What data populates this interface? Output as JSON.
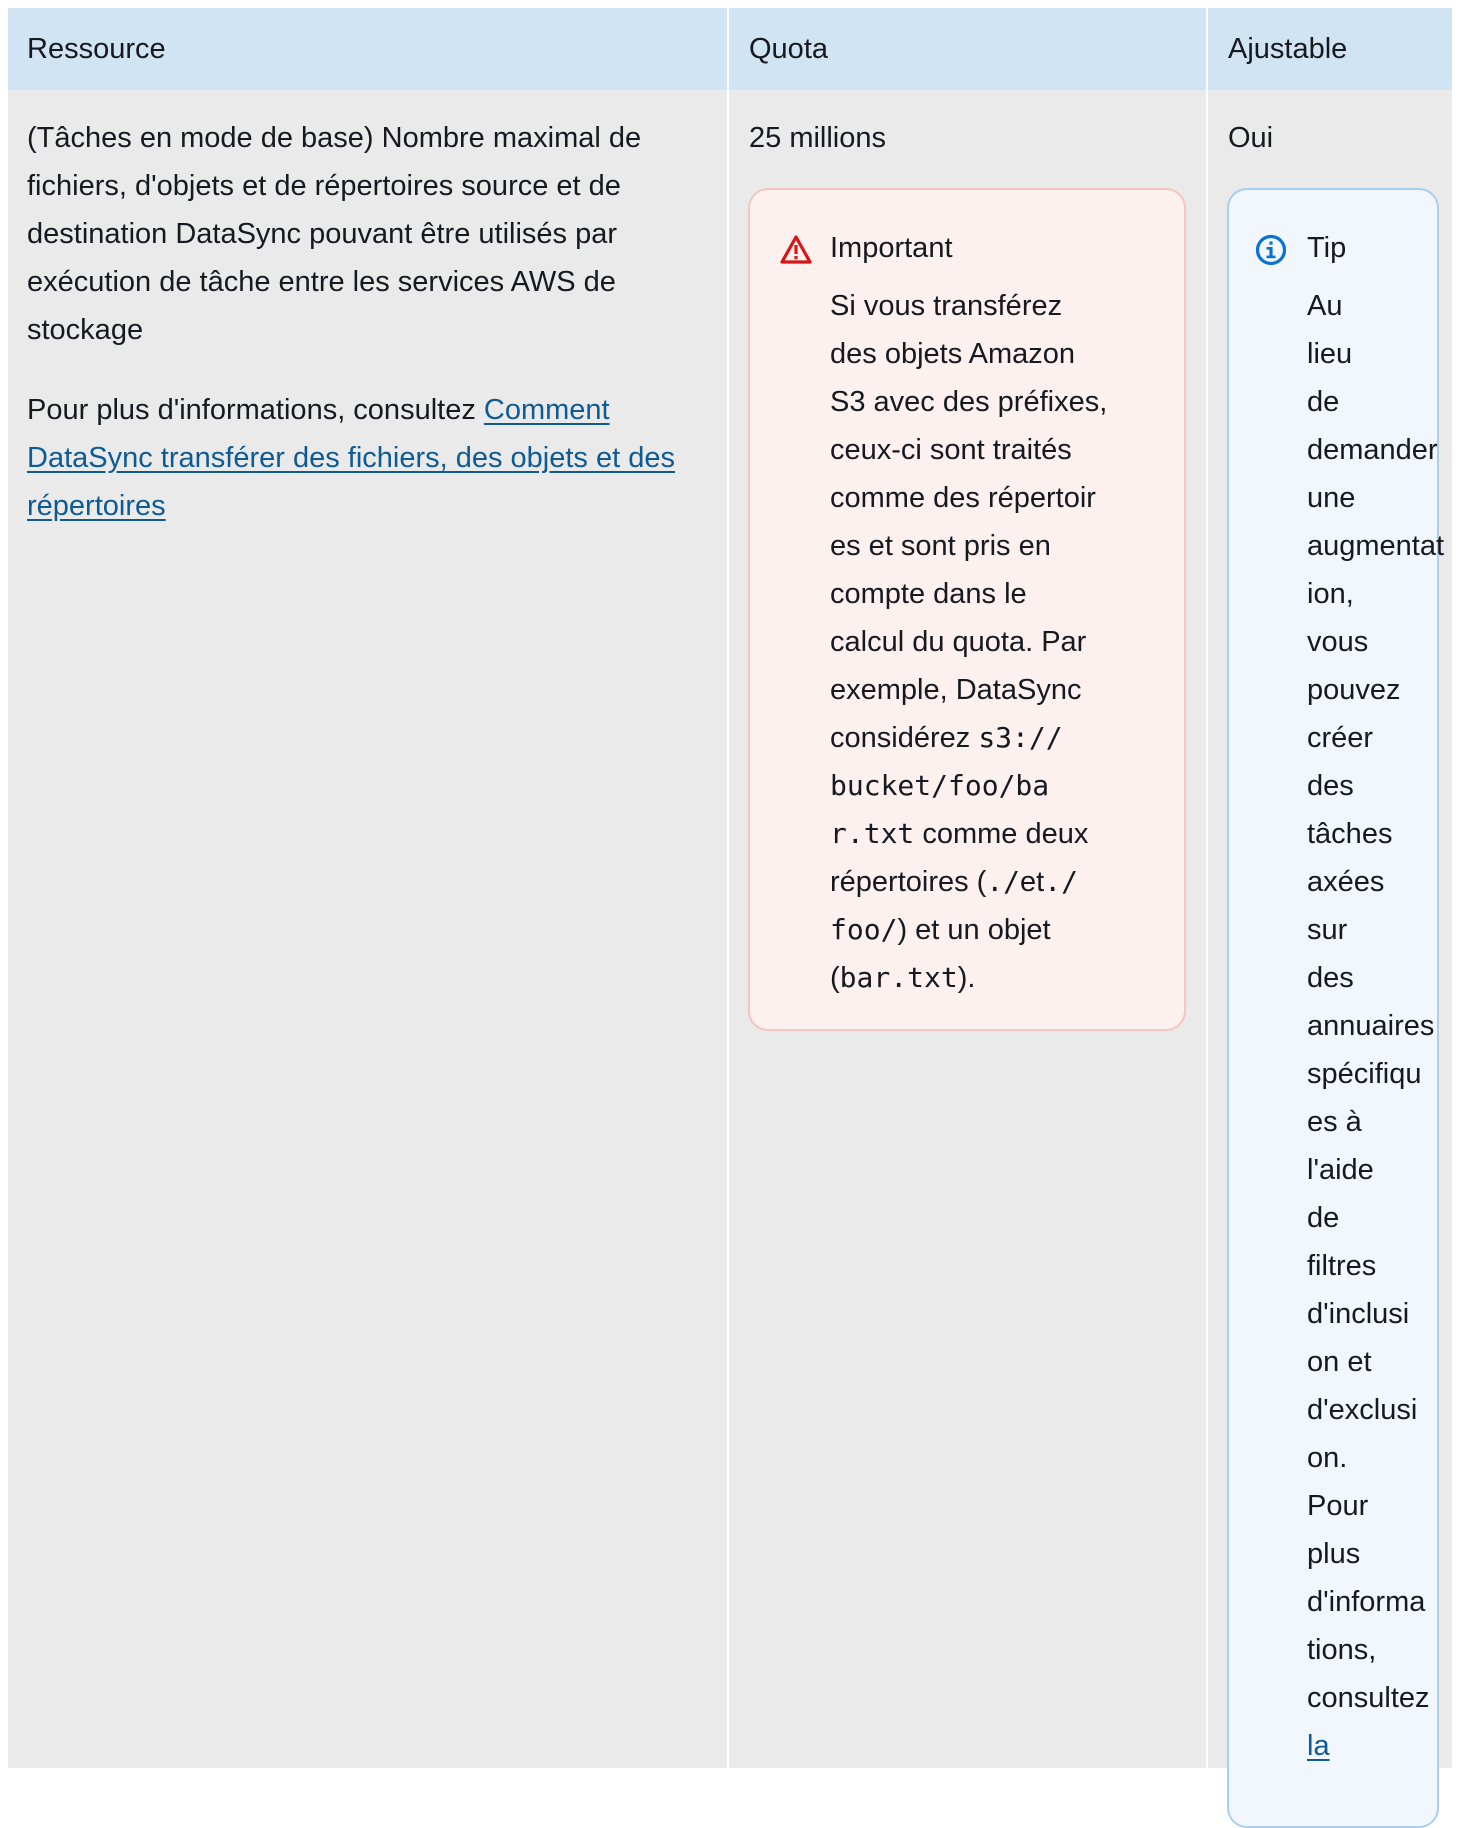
{
  "table": {
    "headers": {
      "resource": "Ressource",
      "quota": "Quota",
      "adjustable": "Ajustable"
    },
    "row": {
      "resource_description": "(Tâches en mode de base) Nombre maximal de fichiers, d'objets et de répertoires source et de destination DataSync pouvant être utilisés par exécution de tâche entre les services AWS de stockage",
      "more_info_prefix": "Pour plus d'informations, consultez ",
      "more_info_link": "Comment DataSync transférer des fichiers, des objets et des répertoires",
      "quota_value": "25 millions",
      "adjustable_value": "Oui"
    }
  },
  "important_alert": {
    "icon": "warning-triangle-icon",
    "title": "Important",
    "lines": [
      "Si vous transférez",
      "des objets Amazon",
      "S3 avec des préfixes,",
      "ceux-ci sont traités",
      "comme des répertoir",
      "es et sont pris en",
      "compte dans le",
      "calcul du quota. Par",
      "exemple, DataSync",
      "considérez ",
      "s3://",
      "bucket/foo/ba",
      "r.txt",
      " comme deux",
      "répertoires (",
      "./",
      "et",
      "./",
      "foo/",
      ") et un objet",
      "(",
      "bar.txt",
      ")."
    ],
    "color_icon": "#d91515"
  },
  "tip_alert": {
    "icon": "info-circle-icon",
    "title": "Tip",
    "words": [
      "Au",
      "lieu",
      "de",
      "demander",
      "une",
      "augmentat",
      "ion,",
      "vous",
      "pouvez",
      "créer",
      "des",
      "tâches",
      "axées",
      "sur",
      "des",
      "annuaires",
      "spécifiqu",
      "es à",
      "l'aide",
      "de",
      "filtres",
      "d'inclusi",
      "on et",
      "d'exclusi",
      "on.",
      "Pour",
      "plus",
      "d'informa",
      "tions,",
      "consultez"
    ],
    "link_word": "la",
    "color_icon": "#0972d3"
  },
  "colors": {
    "header_bg": "#d1e4f4",
    "row_bg": "#eaeaeb",
    "link": "#0e5a94"
  }
}
